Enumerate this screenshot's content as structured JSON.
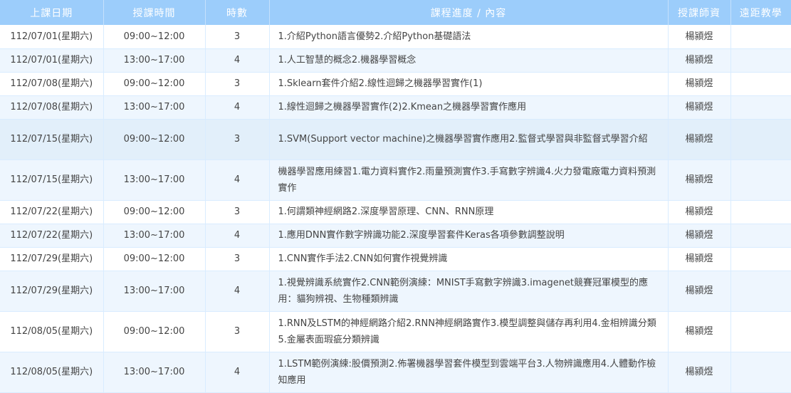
{
  "headers": {
    "date": "上課日期",
    "time": "授課時間",
    "hours": "時數",
    "content": "課程進度 / 內容",
    "teacher": "授課師資",
    "remote": "遠距教學"
  },
  "rows": [
    {
      "date": "112/07/01(星期六)",
      "time": "09:00~12:00",
      "hours": "3",
      "content": "1.介紹Python語言優勢2.介紹Python基礎語法",
      "teacher": "楊潁煜",
      "remote": ""
    },
    {
      "date": "112/07/01(星期六)",
      "time": "13:00~17:00",
      "hours": "4",
      "content": "1.人工智慧的概念2.機器學習概念",
      "teacher": "楊潁煜",
      "remote": ""
    },
    {
      "date": "112/07/08(星期六)",
      "time": "09:00~12:00",
      "hours": "3",
      "content": "1.Sklearn套件介紹2.線性迴歸之機器學習實作(1)",
      "teacher": "楊潁煜",
      "remote": ""
    },
    {
      "date": "112/07/08(星期六)",
      "time": "13:00~17:00",
      "hours": "4",
      "content": "1.線性迴歸之機器學習實作(2)2.Kmean之機器學習實作應用",
      "teacher": "楊潁煜",
      "remote": ""
    },
    {
      "date": "112/07/15(星期六)",
      "time": "09:00~12:00",
      "hours": "3",
      "content": "1.SVM(Support vector machine)之機器學習實作應用2.監督式學習與非監督式學習介紹",
      "teacher": "楊潁煜",
      "remote": ""
    },
    {
      "date": "112/07/15(星期六)",
      "time": "13:00~17:00",
      "hours": "4",
      "content": "機器學習應用練習1.電力資料實作2.雨量預測實作3.手寫數字辨識4.火力發電廠電力資料預測實作",
      "teacher": "楊潁煜",
      "remote": ""
    },
    {
      "date": "112/07/22(星期六)",
      "time": "09:00~12:00",
      "hours": "3",
      "content": "1.何謂類神經網路2.深度學習原理、CNN、RNN原理",
      "teacher": "楊潁煜",
      "remote": ""
    },
    {
      "date": "112/07/22(星期六)",
      "time": "13:00~17:00",
      "hours": "4",
      "content": "1.應用DNN實作數字辨識功能2.深度學習套件Keras各項參數調整說明",
      "teacher": "楊潁煜",
      "remote": ""
    },
    {
      "date": "112/07/29(星期六)",
      "time": "09:00~12:00",
      "hours": "3",
      "content": "1.CNN實作手法2.CNN如何實作視覺辨識",
      "teacher": "楊潁煜",
      "remote": ""
    },
    {
      "date": "112/07/29(星期六)",
      "time": "13:00~17:00",
      "hours": "4",
      "content": "1.視覺辨識系統實作2.CNN範例演練：MNIST手寫數字辨識3.imagenet競賽冠軍模型的應用：貓狗辨視、生物種類辨識",
      "teacher": "楊潁煜",
      "remote": ""
    },
    {
      "date": "112/08/05(星期六)",
      "time": "09:00~12:00",
      "hours": "3",
      "content": "1.RNN及LSTM的神經網路介紹2.RNN神經網路實作3.模型調整與儲存再利用4.金相辨識分類5.金屬表面瑕疵分類辨識",
      "teacher": "楊潁煜",
      "remote": ""
    },
    {
      "date": "112/08/05(星期六)",
      "time": "13:00~17:00",
      "hours": "4",
      "content": "1.LSTM範例演練:股價預測2.佈署機器學習套件模型到雲端平台3.人物辨識應用4.人體動作檢知應用",
      "teacher": "楊潁煜",
      "remote": ""
    }
  ]
}
